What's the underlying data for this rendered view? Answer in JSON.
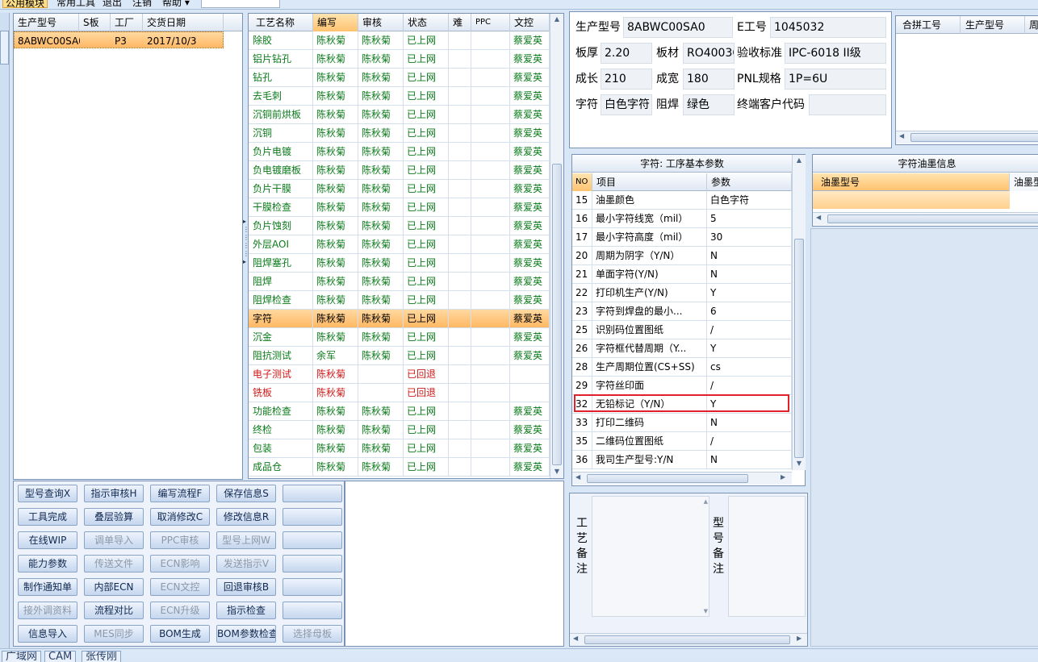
{
  "menubar": {
    "items": [
      "公用模块",
      "常用工具",
      "退出",
      "注销",
      "帮助 ▾"
    ],
    "combo_value": ""
  },
  "model_list": {
    "columns": [
      "生产型号",
      "S板",
      "工厂",
      "交货日期"
    ],
    "rows": [
      {
        "model": "8ABWC00SA0",
        "s_board": "",
        "factory": "P3",
        "delivery": "2017/10/3"
      }
    ]
  },
  "process_grid": {
    "columns": [
      "工艺名称",
      "编写",
      "审核",
      "状态",
      "难",
      "PPC",
      "文控"
    ],
    "rows": [
      {
        "name": "除胶",
        "author": "陈秋菊",
        "reviewer": "陈秋菊",
        "status": "已上网",
        "difficulty": "",
        "ppc": "",
        "control": "蔡爱英",
        "state": "ok"
      },
      {
        "name": "铝片钻孔",
        "author": "陈秋菊",
        "reviewer": "陈秋菊",
        "status": "已上网",
        "difficulty": "",
        "ppc": "",
        "control": "蔡爱英",
        "state": "ok"
      },
      {
        "name": "钻孔",
        "author": "陈秋菊",
        "reviewer": "陈秋菊",
        "status": "已上网",
        "difficulty": "",
        "ppc": "",
        "control": "蔡爱英",
        "state": "ok"
      },
      {
        "name": "去毛刺",
        "author": "陈秋菊",
        "reviewer": "陈秋菊",
        "status": "已上网",
        "difficulty": "",
        "ppc": "",
        "control": "蔡爱英",
        "state": "ok"
      },
      {
        "name": "沉铜前烘板",
        "author": "陈秋菊",
        "reviewer": "陈秋菊",
        "status": "已上网",
        "difficulty": "",
        "ppc": "",
        "control": "蔡爱英",
        "state": "ok"
      },
      {
        "name": "沉铜",
        "author": "陈秋菊",
        "reviewer": "陈秋菊",
        "status": "已上网",
        "difficulty": "",
        "ppc": "",
        "control": "蔡爱英",
        "state": "ok"
      },
      {
        "name": "负片电镀",
        "author": "陈秋菊",
        "reviewer": "陈秋菊",
        "status": "已上网",
        "difficulty": "",
        "ppc": "",
        "control": "蔡爱英",
        "state": "ok"
      },
      {
        "name": "负电镀磨板",
        "author": "陈秋菊",
        "reviewer": "陈秋菊",
        "status": "已上网",
        "difficulty": "",
        "ppc": "",
        "control": "蔡爱英",
        "state": "ok"
      },
      {
        "name": "负片干膜",
        "author": "陈秋菊",
        "reviewer": "陈秋菊",
        "status": "已上网",
        "difficulty": "",
        "ppc": "",
        "control": "蔡爱英",
        "state": "ok"
      },
      {
        "name": "干膜检查",
        "author": "陈秋菊",
        "reviewer": "陈秋菊",
        "status": "已上网",
        "difficulty": "",
        "ppc": "",
        "control": "蔡爱英",
        "state": "ok"
      },
      {
        "name": "负片蚀刻",
        "author": "陈秋菊",
        "reviewer": "陈秋菊",
        "status": "已上网",
        "difficulty": "",
        "ppc": "",
        "control": "蔡爱英",
        "state": "ok"
      },
      {
        "name": "外层AOI",
        "author": "陈秋菊",
        "reviewer": "陈秋菊",
        "status": "已上网",
        "difficulty": "",
        "ppc": "",
        "control": "蔡爱英",
        "state": "ok"
      },
      {
        "name": "阻焊塞孔",
        "author": "陈秋菊",
        "reviewer": "陈秋菊",
        "status": "已上网",
        "difficulty": "",
        "ppc": "",
        "control": "蔡爱英",
        "state": "ok"
      },
      {
        "name": "阻焊",
        "author": "陈秋菊",
        "reviewer": "陈秋菊",
        "status": "已上网",
        "difficulty": "",
        "ppc": "",
        "control": "蔡爱英",
        "state": "ok"
      },
      {
        "name": "阻焊检查",
        "author": "陈秋菊",
        "reviewer": "陈秋菊",
        "status": "已上网",
        "difficulty": "",
        "ppc": "",
        "control": "蔡爱英",
        "state": "ok"
      },
      {
        "name": "字符",
        "author": "陈秋菊",
        "reviewer": "陈秋菊",
        "status": "已上网",
        "difficulty": "",
        "ppc": "",
        "control": "蔡爱英",
        "state": "selected"
      },
      {
        "name": "沉金",
        "author": "陈秋菊",
        "reviewer": "陈秋菊",
        "status": "已上网",
        "difficulty": "",
        "ppc": "",
        "control": "蔡爱英",
        "state": "ok"
      },
      {
        "name": "阻抗测试",
        "author": "余军",
        "reviewer": "陈秋菊",
        "status": "已上网",
        "difficulty": "",
        "ppc": "",
        "control": "蔡爱英",
        "state": "ok"
      },
      {
        "name": "电子测试",
        "author": "陈秋菊",
        "reviewer": "",
        "status": "已回退",
        "difficulty": "",
        "ppc": "",
        "control": "",
        "state": "bad"
      },
      {
        "name": "铣板",
        "author": "陈秋菊",
        "reviewer": "",
        "status": "已回退",
        "difficulty": "",
        "ppc": "",
        "control": "",
        "state": "bad"
      },
      {
        "name": "功能检查",
        "author": "陈秋菊",
        "reviewer": "陈秋菊",
        "status": "已上网",
        "difficulty": "",
        "ppc": "",
        "control": "蔡爱英",
        "state": "ok"
      },
      {
        "name": "终检",
        "author": "陈秋菊",
        "reviewer": "陈秋菊",
        "status": "已上网",
        "difficulty": "",
        "ppc": "",
        "control": "蔡爱英",
        "state": "ok"
      },
      {
        "name": "包装",
        "author": "陈秋菊",
        "reviewer": "陈秋菊",
        "status": "已上网",
        "difficulty": "",
        "ppc": "",
        "control": "蔡爱英",
        "state": "ok"
      },
      {
        "name": "成品仓",
        "author": "陈秋菊",
        "reviewer": "陈秋菊",
        "status": "已上网",
        "difficulty": "",
        "ppc": "",
        "control": "蔡爱英",
        "state": "ok"
      }
    ]
  },
  "buttons": [
    [
      "型号查询X",
      "指示审核H",
      "编写流程F",
      "保存信息S",
      ""
    ],
    [
      "工具完成",
      "叠层验算",
      "取消修改C",
      "修改信息R",
      ""
    ],
    [
      "在线WIP",
      "调单导入",
      "PPC审核",
      "型号上网W",
      ""
    ],
    [
      "能力参数",
      "传送文件",
      "ECN影响",
      "发送指示V",
      ""
    ],
    [
      "制作通知单",
      "内部ECN",
      "ECN文控",
      "回退审核B",
      ""
    ],
    [
      "接外调资料",
      "流程对比",
      "ECN升级",
      "指示检查",
      ""
    ],
    [
      "信息导入",
      "MES同步",
      "BOM生成",
      "BOM参数检查",
      "选择母板"
    ]
  ],
  "buttons_disabled": [
    [
      false,
      false,
      false,
      false,
      false
    ],
    [
      false,
      false,
      false,
      false,
      false
    ],
    [
      false,
      true,
      true,
      true,
      false
    ],
    [
      false,
      true,
      true,
      true,
      false
    ],
    [
      false,
      false,
      true,
      false,
      false
    ],
    [
      true,
      false,
      true,
      false,
      false
    ],
    [
      false,
      true,
      false,
      false,
      true
    ]
  ],
  "info": {
    "model_label": "生产型号",
    "model_value": "8ABWC00SA0",
    "eno_label": "E工号",
    "eno_value": "1045032",
    "thickness_label": "板厚",
    "thickness_value": "2.20",
    "material_label": "板材",
    "material_value": "RO4003C",
    "standard_label": "验收标准",
    "standard_value": "IPC-6018 II级",
    "length_label": "成长",
    "length_value": "210",
    "width_label": "成宽",
    "width_value": "180",
    "pnl_label": "PNL规格",
    "pnl_value": "1P=6U",
    "char_label": "字符",
    "char_value": "白色字符",
    "mask_label": "阻焊",
    "mask_value": "绿色",
    "customer_label": "终端客户代码",
    "customer_value": ""
  },
  "merge_grid": {
    "columns": [
      "合拼工号",
      "生产型号",
      "周"
    ]
  },
  "params": {
    "title": "字符: 工序基本参数",
    "columns": [
      "NO",
      "项目",
      "参数"
    ],
    "rows": [
      {
        "no": "15",
        "item": "油墨颜色",
        "value": "白色字符"
      },
      {
        "no": "16",
        "item": "最小字符线宽（mil）",
        "value": "5"
      },
      {
        "no": "17",
        "item": "最小字符高度（mil）",
        "value": "30"
      },
      {
        "no": "20",
        "item": "周期为阴字（Y/N）",
        "value": "N"
      },
      {
        "no": "21",
        "item": "单面字符(Y/N)",
        "value": "N"
      },
      {
        "no": "22",
        "item": "打印机生产(Y/N)",
        "value": "Y"
      },
      {
        "no": "23",
        "item": "字符到焊盘的最小...",
        "value": "6"
      },
      {
        "no": "25",
        "item": "识别码位置图纸",
        "value": "/"
      },
      {
        "no": "26",
        "item": "字符框代替周期（Y...",
        "value": "Y"
      },
      {
        "no": "28",
        "item": "生产周期位置(CS+SS)",
        "value": "cs"
      },
      {
        "no": "29",
        "item": "字符丝印面",
        "value": "/"
      },
      {
        "no": "32",
        "item": "无铅标记（Y/N）",
        "value": "Y"
      },
      {
        "no": "33",
        "item": "打印二维码",
        "value": "N"
      },
      {
        "no": "35",
        "item": "二维码位置图纸",
        "value": "/"
      },
      {
        "no": "36",
        "item": "我司生产型号:Y/N",
        "value": "N"
      }
    ],
    "highlighted_no": "32",
    "highlight_color": "#e0202a"
  },
  "ink": {
    "title": "字符油墨信息",
    "columns": [
      "油墨型号",
      "油墨型"
    ]
  },
  "notes": {
    "process_label": "工艺备注",
    "model_label": "型号备注"
  },
  "tabs": [
    "广域网",
    "CAM",
    "张传刚"
  ]
}
